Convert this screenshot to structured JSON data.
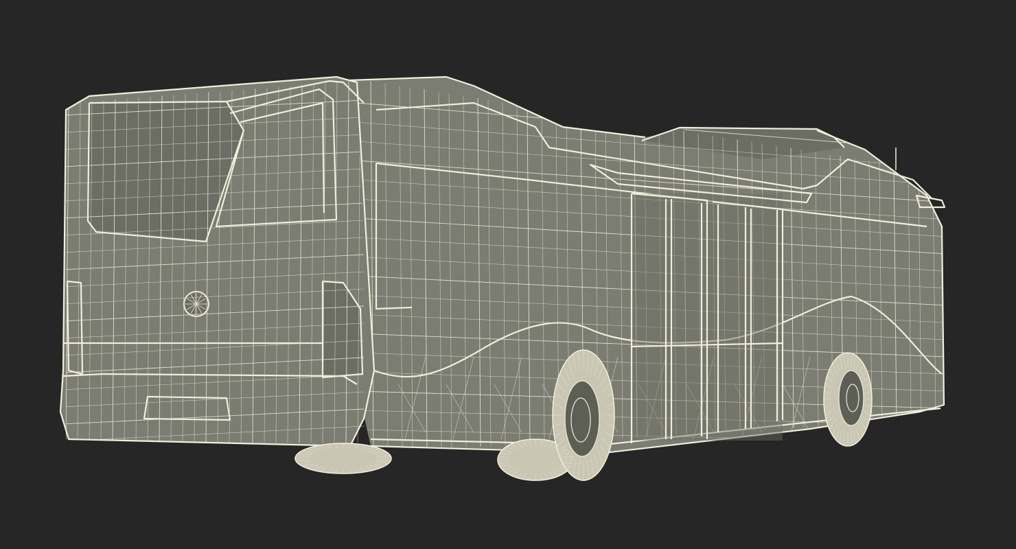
{
  "scene": {
    "subject": "bus-wireframe",
    "background_color": "#262626",
    "wireframe_color": "#f1efdc",
    "surface_color": "#7b7c72"
  }
}
